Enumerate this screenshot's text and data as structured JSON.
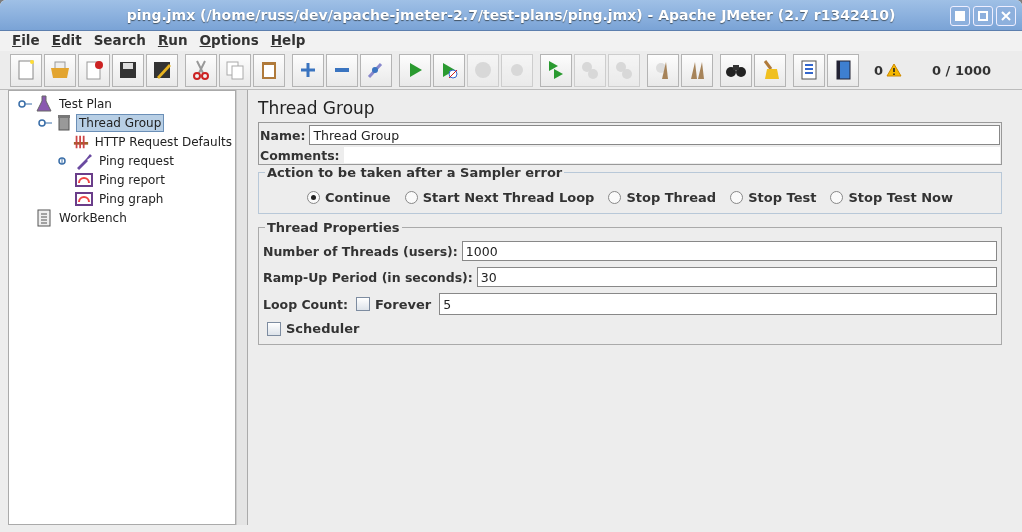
{
  "window": {
    "title": "ping.jmx (/home/russ/dev/apache-jmeter-2.7/test-plans/ping.jmx) - Apache JMeter (2.7 r1342410)"
  },
  "menu": [
    {
      "label": "File",
      "underlined": true
    },
    {
      "label": "Edit",
      "underlined": true
    },
    {
      "label": "Search",
      "underlined": false
    },
    {
      "label": "Run",
      "underlined": true
    },
    {
      "label": "Options",
      "underlined": true
    },
    {
      "label": "Help",
      "underlined": true
    }
  ],
  "toolbar": {
    "groups": [
      [
        {
          "kind": "new",
          "disabled": false
        },
        {
          "kind": "open",
          "disabled": false
        },
        {
          "kind": "close",
          "disabled": false
        },
        {
          "kind": "save",
          "disabled": false
        },
        {
          "kind": "save-as",
          "disabled": false
        }
      ],
      [
        {
          "kind": "cut",
          "disabled": false
        },
        {
          "kind": "copy",
          "disabled": false
        },
        {
          "kind": "paste",
          "disabled": false
        }
      ],
      [
        {
          "kind": "expand",
          "disabled": false
        },
        {
          "kind": "collapse",
          "disabled": false
        },
        {
          "kind": "toggle",
          "disabled": false
        }
      ],
      [
        {
          "kind": "start",
          "disabled": false
        },
        {
          "kind": "start-no-timers",
          "disabled": false
        },
        {
          "kind": "stop",
          "disabled": true
        },
        {
          "kind": "shutdown",
          "disabled": true
        }
      ],
      [
        {
          "kind": "remote-start",
          "disabled": false
        },
        {
          "kind": "remote-stop",
          "disabled": true
        },
        {
          "kind": "remote-shutdown",
          "disabled": true
        }
      ],
      [
        {
          "kind": "clear",
          "disabled": false
        },
        {
          "kind": "clear-all",
          "disabled": false
        }
      ],
      [
        {
          "kind": "search",
          "disabled": false
        },
        {
          "kind": "reset",
          "disabled": false
        }
      ],
      [
        {
          "kind": "function",
          "disabled": false
        },
        {
          "kind": "help",
          "disabled": false
        }
      ]
    ],
    "error_count": "0",
    "threads": "0 / 1000"
  },
  "tree": [
    {
      "label": "Test Plan",
      "kind": "plan",
      "selected": false,
      "expanded": true,
      "children": [
        {
          "label": "Thread Group",
          "kind": "threads",
          "selected": true,
          "expanded": true,
          "children": [
            {
              "label": "HTTP Request Defaults",
              "kind": "config",
              "selected": false
            },
            {
              "label": "Ping request",
              "kind": "sampler",
              "selected": false,
              "expanded": false
            },
            {
              "label": "Ping report",
              "kind": "listener",
              "selected": false
            },
            {
              "label": "Ping graph",
              "kind": "listener",
              "selected": false
            }
          ]
        }
      ]
    },
    {
      "label": "WorkBench",
      "kind": "workbench",
      "selected": false
    }
  ],
  "panel": {
    "title": "Thread Group",
    "name_label": "Name:",
    "name_value": "Thread Group",
    "comments_label": "Comments:",
    "error_action": {
      "title": "Action to be taken after a Sampler error",
      "options": [
        {
          "label": "Continue",
          "selected": true
        },
        {
          "label": "Start Next Thread Loop",
          "selected": false
        },
        {
          "label": "Stop Thread",
          "selected": false
        },
        {
          "label": "Stop Test",
          "selected": false
        },
        {
          "label": "Stop Test Now",
          "selected": false
        }
      ]
    },
    "properties": {
      "title": "Thread Properties",
      "threads_label": "Number of Threads (users):",
      "threads_value": "1000",
      "rampup_label": "Ramp-Up Period (in seconds):",
      "rampup_value": "30",
      "loop_label": "Loop Count:",
      "forever": {
        "label": "Forever",
        "checked": false
      },
      "loop_value": "5",
      "scheduler": {
        "label": "Scheduler",
        "checked": false
      }
    }
  }
}
